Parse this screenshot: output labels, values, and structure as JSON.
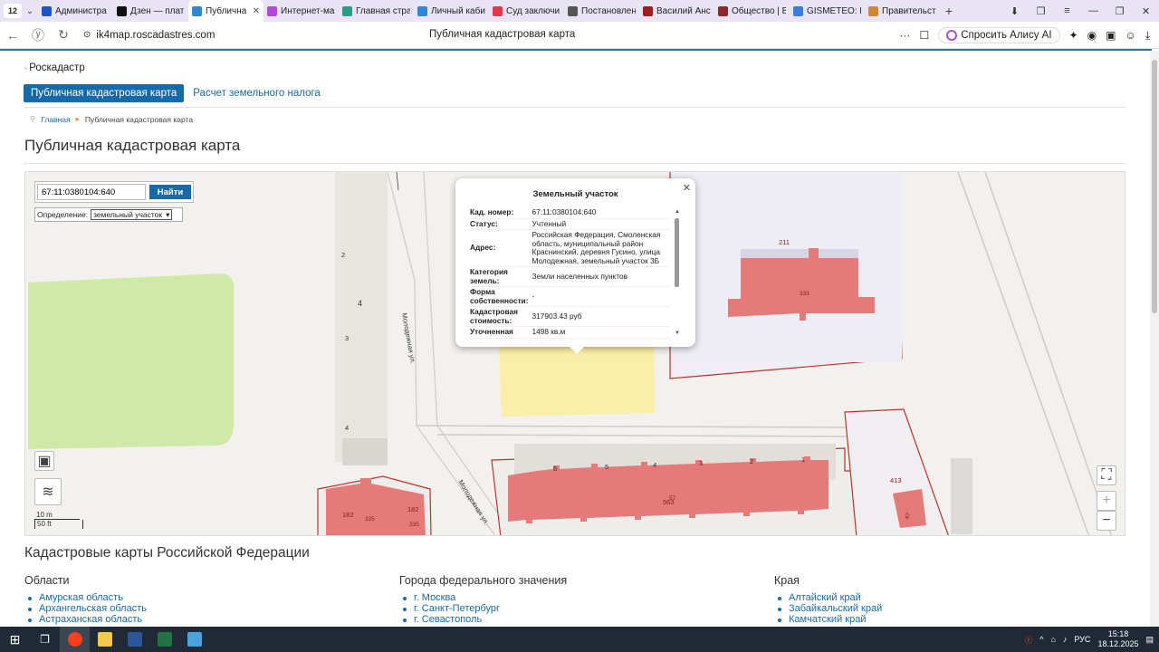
{
  "browser": {
    "tab_count": "12",
    "tabs": [
      {
        "title": "Администра",
        "color": "#1a56c9"
      },
      {
        "title": "Дзен — плат",
        "color": "#111111"
      },
      {
        "title": "Публична",
        "color": "#2a8ad6",
        "active": true
      },
      {
        "title": "Интернет-ма",
        "color": "#b34ad6"
      },
      {
        "title": "Главная стра",
        "color": "#2a9c8a"
      },
      {
        "title": "Личный каби",
        "color": "#2a8ad6"
      },
      {
        "title": "Суд заключи",
        "color": "#e0384a"
      },
      {
        "title": "Постановлен",
        "color": "#555555"
      },
      {
        "title": "Василий Анс",
        "color": "#a11d1d"
      },
      {
        "title": "Общество | В",
        "color": "#8a2a2a"
      },
      {
        "title": "GISMETEO: П",
        "color": "#3a7ee0"
      },
      {
        "title": "Правительст",
        "color": "#d08a2a"
      }
    ],
    "url": "ik4map.roscadastres.com",
    "page_title": "Публичная кадастровая карта",
    "alice_label": "Спросить Алису AI"
  },
  "site": {
    "logo_alt": "Роскадастр",
    "nav": [
      "Публичная кадастровая карта",
      "Расчет земельного налога"
    ],
    "breadcrumbs": [
      "Главная",
      "Публичная кадастровая карта"
    ],
    "heading": "Публичная кадастровая карта"
  },
  "map": {
    "search_value": "67:11:0380104:640",
    "search_button": "Найти",
    "definition_label": "Определение:",
    "definition_value": "земельный участок",
    "scale_m": "10 m",
    "scale_ft": "50 ft",
    "labels": {
      "n2": "2",
      "n3": "3",
      "n4a": "4",
      "n4b": "4",
      "street1": "Молодежная ул.",
      "street2": "Молодежная ул.",
      "b211": "211",
      "b333": "333",
      "b413": "413",
      "b47": "47",
      "b182a": "182",
      "b182b": "182",
      "b335a": "335",
      "b335b": "335",
      "b563": "563",
      "b57": "57",
      "e1": "1",
      "e2": "2",
      "e3": "3",
      "e4": "4",
      "e5": "5",
      "e6": "6"
    }
  },
  "popup": {
    "title": "Земельный участок",
    "rows": [
      {
        "k": "Кад. номер:",
        "v": "67:11:0380104:640"
      },
      {
        "k": "Статус:",
        "v": "Учтенный"
      },
      {
        "k": "Адрес:",
        "v": "Российская Федерация, Смоленская область, муниципальный район Краснинский, деревня Гусино, улица Молодежная, земельный участок 3Б"
      },
      {
        "k": "Категория земель:",
        "v": "Земли населенных пунктов"
      },
      {
        "k": "Форма собственности:",
        "v": "-"
      },
      {
        "k": "Кадастровая стоимость:",
        "v": "317903.43 руб"
      },
      {
        "k": "Уточненная",
        "v": "1498 кв.м"
      }
    ]
  },
  "lists": {
    "heading": "Кадастровые карты Российской Федерации",
    "regions": {
      "title": "Области",
      "items": [
        "Амурская область",
        "Архангельская область",
        "Астраханская область"
      ]
    },
    "cities": {
      "title": "Города федерального значения",
      "items": [
        "г. Москва",
        "г. Санкт-Петербург",
        "г. Севастополь"
      ]
    },
    "krai": {
      "title": "Края",
      "items": [
        "Алтайский край",
        "Забайкальский край",
        "Камчатский край"
      ]
    }
  },
  "taskbar": {
    "lang": "РУС",
    "time": "15:18",
    "date": "18.12.2025"
  },
  "colors": {
    "accent": "#1769a8",
    "parcel_red": "#e57a7a",
    "parcel_yellow": "#fbeea6",
    "green_area": "#cfeaa8"
  }
}
